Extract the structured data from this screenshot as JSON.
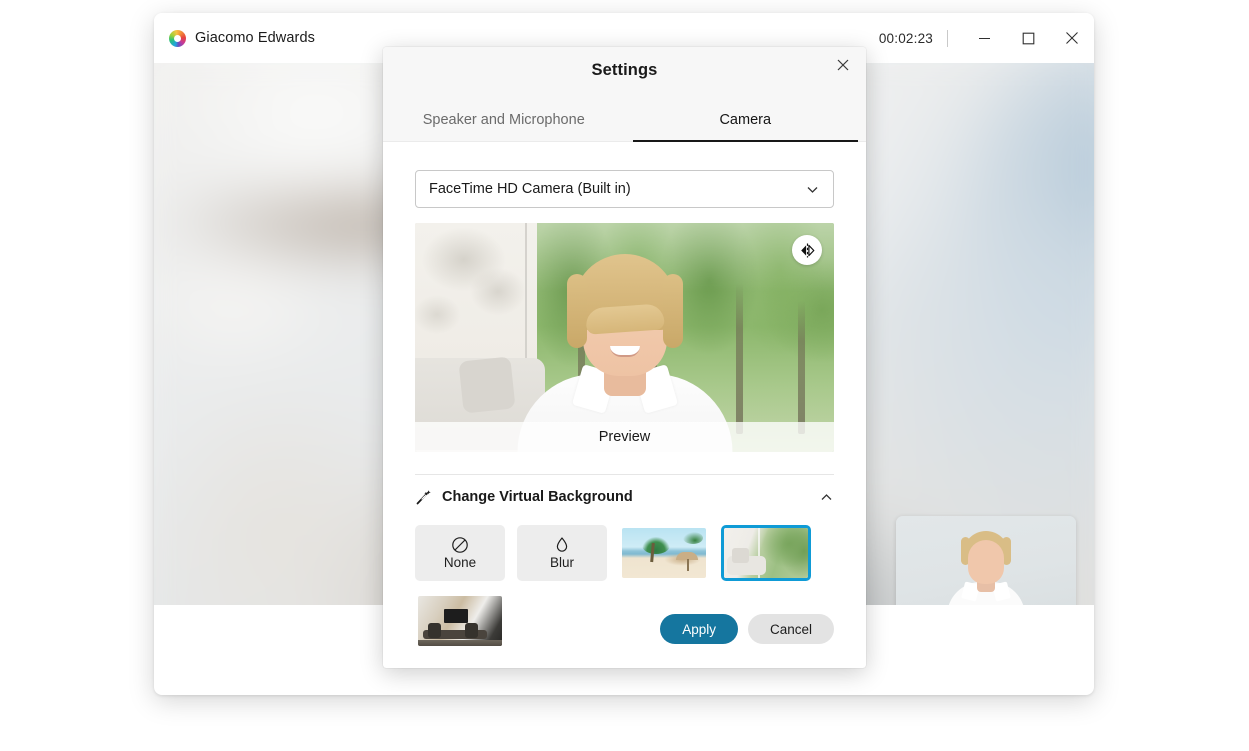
{
  "window": {
    "brand_name": "Giacomo Edwards",
    "brand_logo_icon": "app-ring-logo",
    "call_timer": "00:02:23",
    "minimize_icon": "minimize-icon",
    "maximize_icon": "maximize-icon",
    "close_icon": "close-icon"
  },
  "dialog": {
    "title": "Settings",
    "close_icon": "close-icon",
    "tabs": [
      {
        "label": "Speaker and Microphone",
        "active": false
      },
      {
        "label": "Camera",
        "active": true
      }
    ],
    "camera_select": {
      "value": "FaceTime HD Camera (Built in)",
      "chevron_icon": "chevron-down-icon"
    },
    "preview": {
      "label": "Preview",
      "mirror_icon": "mirror-flip-icon"
    },
    "virtual_background": {
      "section_icon": "magic-wand-icon",
      "title": "Change Virtual Background",
      "collapse_icon": "chevron-up-icon",
      "options": [
        {
          "label": "None",
          "icon": "no-entry-icon",
          "type": "plain",
          "selected": false
        },
        {
          "label": "Blur",
          "icon": "water-drop-icon",
          "type": "plain",
          "selected": false
        },
        {
          "label": "Beach with palm trees",
          "icon": "beach-thumbnail",
          "type": "image",
          "selected": false
        },
        {
          "label": "Living room with forest view",
          "icon": "living-room-thumbnail",
          "type": "image",
          "selected": true
        },
        {
          "label": "Modern lounge interior",
          "icon": "office-lounge-thumbnail",
          "type": "image",
          "selected": false
        }
      ]
    },
    "actions": {
      "apply_label": "Apply",
      "cancel_label": "Cancel"
    }
  },
  "colors": {
    "accent_primary": "#15769f",
    "selection_border": "#0f9bd6",
    "tab_active_underline": "#181818"
  }
}
